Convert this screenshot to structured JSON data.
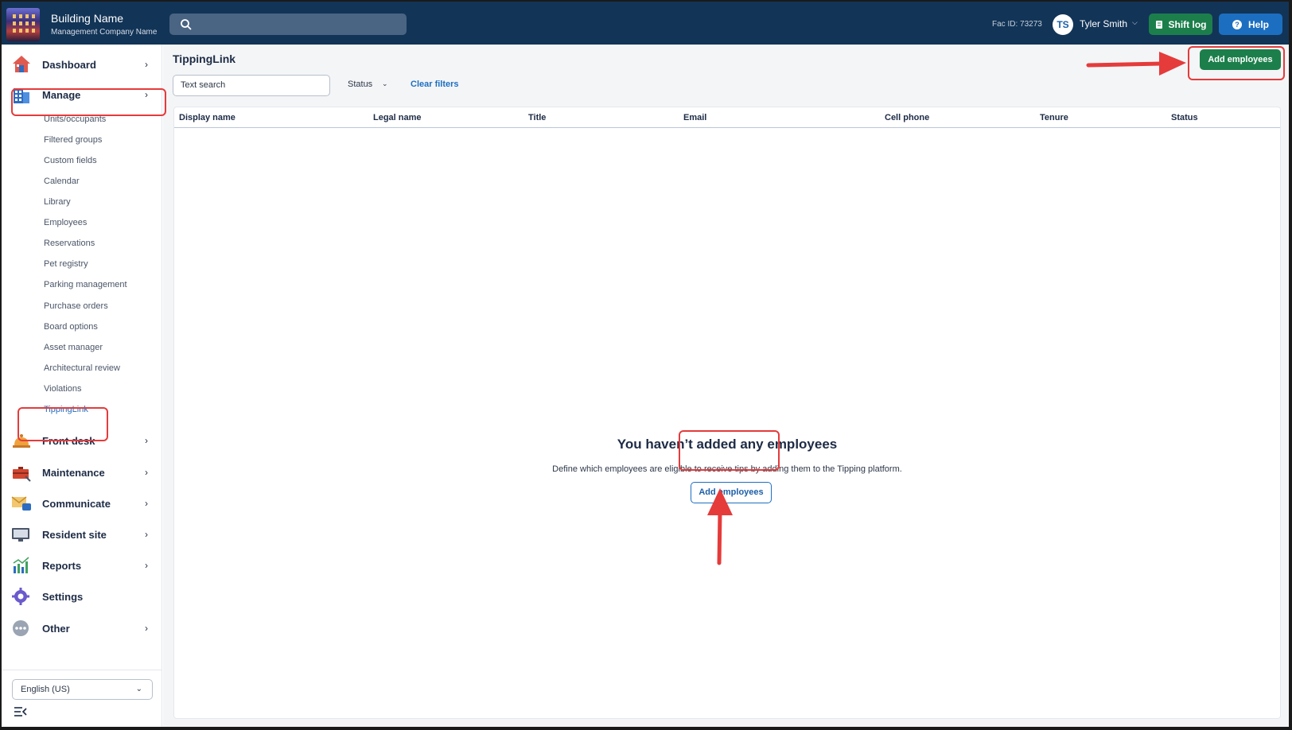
{
  "header": {
    "building_name": "Building Name",
    "company_name": "Management Company Name",
    "fac_id": "Fac ID: 73273",
    "user_initials": "TS",
    "user_name": "Tyler Smith",
    "shift_log_label": "Shift log",
    "help_label": "Help"
  },
  "sidebar": {
    "main_items": [
      {
        "label": "Dashboard",
        "icon": "house-icon"
      },
      {
        "label": "Manage",
        "icon": "building-icon"
      },
      {
        "label": "Front desk",
        "icon": "bell-icon"
      },
      {
        "label": "Maintenance",
        "icon": "toolbox-icon"
      },
      {
        "label": "Communicate",
        "icon": "envelope-chat-icon"
      },
      {
        "label": "Resident site",
        "icon": "monitor-icon"
      },
      {
        "label": "Reports",
        "icon": "chart-icon"
      },
      {
        "label": "Settings",
        "icon": "gear-icon"
      },
      {
        "label": "Other",
        "icon": "more-icon"
      }
    ],
    "manage_subitems": [
      "Units/occupants",
      "Filtered groups",
      "Custom fields",
      "Calendar",
      "Library",
      "Employees",
      "Reservations",
      "Pet registry",
      "Parking management",
      "Purchase orders",
      "Board options",
      "Asset manager",
      "Architectural review",
      "Violations",
      "TippingLink"
    ],
    "active_subitem": "TippingLink",
    "language": "English (US)"
  },
  "main": {
    "title": "TippingLink",
    "search_placeholder": "Text search",
    "status_filter_label": "Status",
    "clear_filters_label": "Clear filters",
    "add_employees_label": "Add employees",
    "columns": [
      "Display name",
      "Legal name",
      "Title",
      "Email",
      "Cell phone",
      "Tenure",
      "Status"
    ],
    "empty_title": "You haven’t added any employees",
    "empty_desc": "Define which employees are eligible to receive tips by adding them to the Tipping platform.",
    "empty_button_label": "Add employees"
  },
  "colors": {
    "topbar": "#123457",
    "primary_green": "#1c7f4b",
    "primary_blue": "#1c6fc0",
    "annotation_red": "#e53b3b"
  }
}
